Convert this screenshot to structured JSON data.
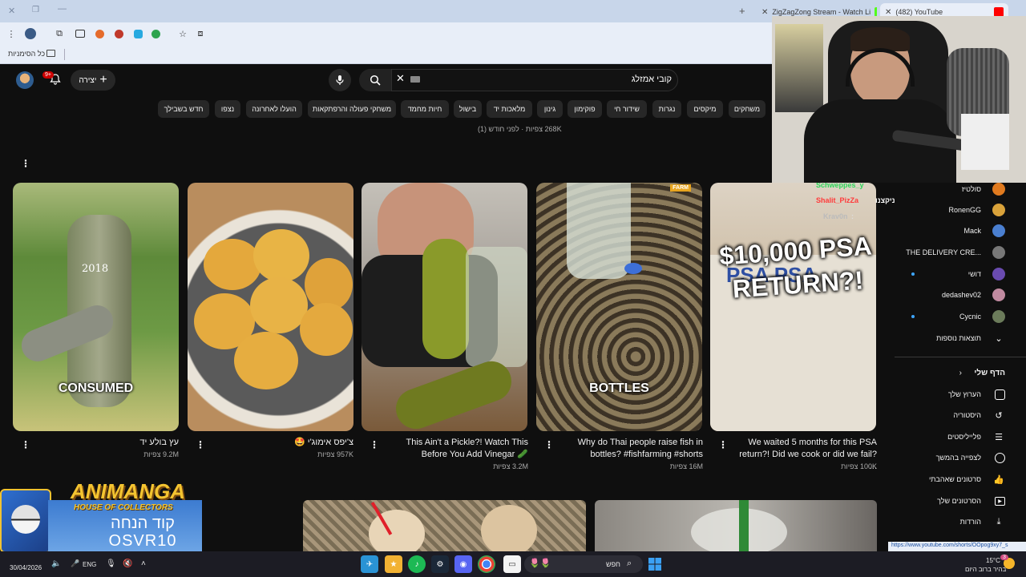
{
  "browser": {
    "tabs": [
      {
        "label": "ZigZagZong Stream - Watch Li",
        "close": "✕"
      },
      {
        "label": "(482) YouTube",
        "close": "✕"
      }
    ],
    "new_tab": "+",
    "bookmarks_label": "כל הסימניות",
    "status_url": "https://www.youtube.com/shorts/OOpog9xy7_s"
  },
  "header": {
    "create_label": "יצירה",
    "notification_badge": "9+",
    "search_query": "קובי אמזלג"
  },
  "chips": [
    "משחקים",
    "מיקסים",
    "נגרות",
    "שידור חי",
    "פוקימון",
    "גינון",
    "מלאכות יד",
    "בישול",
    "חיות מחמד",
    "משחקי פעולה והרפתקאות",
    "הועלו לאחרונה",
    "נצפו",
    "חדש בשבילך"
  ],
  "top_meta": "268K צפיות · לפני חודש (1)",
  "shorts": [
    {
      "title": "עץ בולע יד",
      "views": "9.2M צפיות",
      "overlay": "CONSUMED",
      "year": "2018"
    },
    {
      "title": "צ'יפס אימוג'י 🤩",
      "views": "957K צפיות",
      "overlay": ""
    },
    {
      "title": "This Ain't a Pickle?! Watch This Before You Add Vinegar 🥒",
      "views": "3.2M צפיות",
      "overlay": ""
    },
    {
      "title": "Why do Thai people raise fish in bottles? #fishfarming #shorts",
      "views": "16M צפיות",
      "overlay": "BOTTLES"
    },
    {
      "title": "We waited 5 months for this PSA return?! Did we cook or did we fail? ...",
      "views": "100K צפיות",
      "overlay": "$10,000 PSA RETURN?!"
    }
  ],
  "sidebar": {
    "channels": [
      {
        "name": "סולטיז",
        "icon": "channel-avatar"
      },
      {
        "name": "RonenGG",
        "icon": "channel-avatar"
      },
      {
        "name": "Mack",
        "icon": "channel-avatar"
      },
      {
        "name": "THE DELIVERY CRE...",
        "icon": "channel-avatar"
      },
      {
        "name": "דושי",
        "icon": "channel-avatar"
      },
      {
        "name": "dedashev02",
        "icon": "channel-avatar"
      },
      {
        "name": "Cycnic",
        "icon": "channel-avatar"
      }
    ],
    "show_more": "תוצאות נוספות",
    "you_heading": "הדף שלי",
    "you_items": [
      {
        "label": "הערוץ שלך",
        "icon": "channel-icon"
      },
      {
        "label": "היסטוריה",
        "icon": "history-icon"
      },
      {
        "label": "פלייליסטים",
        "icon": "playlist-icon"
      },
      {
        "label": "לצפייה בהמשך",
        "icon": "clock-icon"
      },
      {
        "label": "סרטונים שאהבתי",
        "icon": "thumb-up-icon"
      },
      {
        "label": "הסרטונים שלך",
        "icon": "video-icon"
      },
      {
        "label": "הורדות",
        "icon": "download-icon"
      }
    ]
  },
  "chat": [
    {
      "user": "Schweppes_y",
      "color": "#2dd45a"
    },
    {
      "user": "Shalit_PizZa",
      "color": "#ff3a3a",
      "msg": "ניקצנו"
    },
    {
      "user": "Krav0n",
      "color": "#bbbbbb",
      "msg": ":"
    }
  ],
  "overlay_logo": {
    "title": "ANIMANGA",
    "subtitle": "HOUSE OF COLLECTORS",
    "code_label": "קוד הנחה",
    "code": "OSVR10"
  },
  "taskbar": {
    "date": "30/04/2026",
    "lang": "ENG",
    "search_placeholder": "חפש",
    "temp": "15°C",
    "weather": "בהיר ברוב היום",
    "notif_count": "3"
  },
  "colors": {
    "accent": "#ff0000",
    "bg": "#0f0f0f",
    "chip": "#272727"
  }
}
